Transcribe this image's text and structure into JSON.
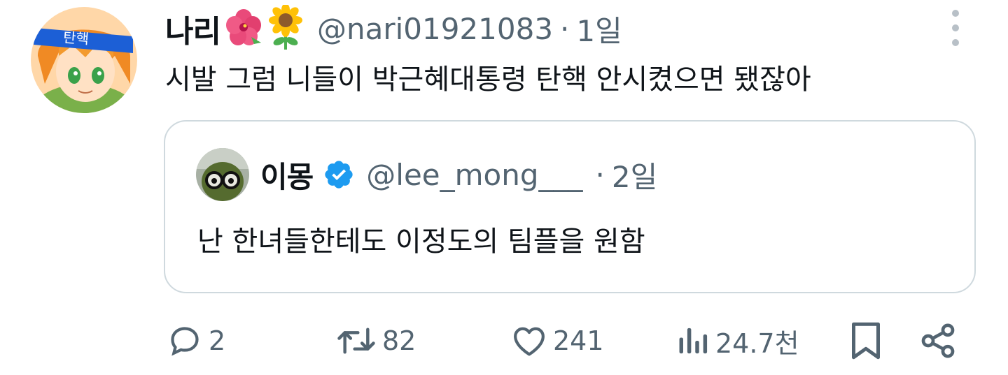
{
  "tweet": {
    "display_name": "나리",
    "name_emojis": [
      "hibiscus-icon",
      "sunflower-icon"
    ],
    "handle": "@nari01921083",
    "separator": "·",
    "time": "1일",
    "text": "시발 그럼 니들이 박근혜대통령 탄핵 안시켰으면 됐잖아",
    "avatar_headband_text": "탄핵"
  },
  "quote": {
    "display_name": "이몽",
    "verified": true,
    "handle": "@lee_mong___",
    "separator": "·",
    "time": "2일",
    "text": "난 한녀들한테도 이정도의 팀플을 원함"
  },
  "actions": {
    "reply_count": "2",
    "retweet_count": "82",
    "like_count": "241",
    "views_count": "24.7천"
  },
  "colors": {
    "text": "#0f1419",
    "secondary": "#536471",
    "verified": "#1d9bf0",
    "border": "#cfd9de"
  }
}
